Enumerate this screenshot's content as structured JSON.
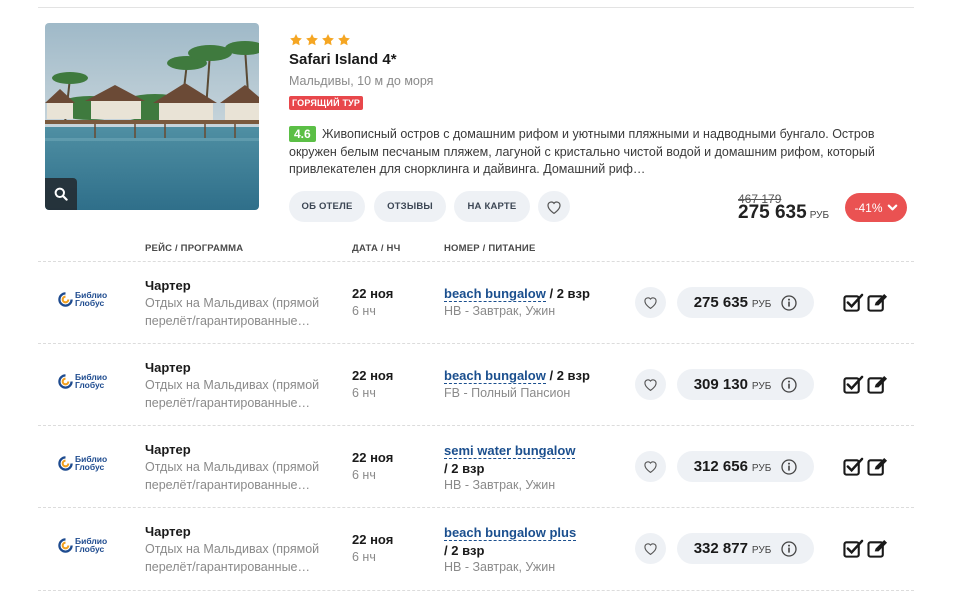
{
  "hotel": {
    "stars": 4,
    "name": "Safari Island 4*",
    "location": "Мальдивы, 10 м до моря",
    "hot_badge": "ГОРЯЩИЙ ТУР",
    "rating": "4.6",
    "description": "Живописный остров с домашним рифом и уютными пляжными и надводными бунгало. Остров окружен белым песчаным пляжем, лагуной с кристально чистой водой и домашним рифом, который привлекателен для снорклинга и дайвинга. Домашний риф…",
    "buttons": {
      "about": "ОБ ОТЕЛЕ",
      "reviews": "ОТЗЫВЫ",
      "map": "НА КАРТЕ"
    },
    "old_price": "467 179",
    "price": "275 635",
    "currency": "РУБ",
    "discount": "-41%"
  },
  "columns": {
    "flight": "РЕЙС / ПРОГРАММА",
    "date": "ДАТА / НЧ",
    "room": "НОМЕР / ПИТАНИЕ"
  },
  "operator": {
    "line1": "Библио",
    "line2": "Глобус"
  },
  "offers": [
    {
      "flight": "Чартер",
      "desc": "Отдых на Мальдивах (прямой перелёт/гарантированные…",
      "date": "22 ноя",
      "nights": "6 нч",
      "room": "beach bungalow",
      "pax": "/ 2 взр",
      "meal": "HB - Завтрак, Ужин",
      "price": "275 635",
      "currency": "РУБ"
    },
    {
      "flight": "Чартер",
      "desc": "Отдых на Мальдивах (прямой перелёт/гарантированные…",
      "date": "22 ноя",
      "nights": "6 нч",
      "room": "beach bungalow",
      "pax": "/ 2 взр",
      "meal": "FB - Полный Пансион",
      "price": "309 130",
      "currency": "РУБ"
    },
    {
      "flight": "Чартер",
      "desc": "Отдых на Мальдивах (прямой перелёт/гарантированные…",
      "date": "22 ноя",
      "nights": "6 нч",
      "room": "semi water bungalow",
      "pax": "/ 2 взр",
      "meal": "HB - Завтрак, Ужин",
      "price": "312 656",
      "currency": "РУБ"
    },
    {
      "flight": "Чартер",
      "desc": "Отдых на Мальдивах (прямой перелёт/гарантированные…",
      "date": "22 ноя",
      "nights": "6 нч",
      "room": "beach bungalow plus",
      "pax": "/ 2 взр",
      "meal": "HB - Завтрак, Ужин",
      "price": "332 877",
      "currency": "РУБ"
    }
  ],
  "colors": {
    "accent_blue": "#1b4f8e",
    "hot_red": "#e8474b",
    "rating_green": "#5bbf46",
    "star": "#f5a623",
    "pill_bg": "#eef1f5"
  },
  "icons": [
    "search-icon",
    "star-icon",
    "heart-icon",
    "chevron-down-icon",
    "info-icon",
    "checkbox-icon",
    "edit-icon",
    "operator-logo-icon"
  ]
}
